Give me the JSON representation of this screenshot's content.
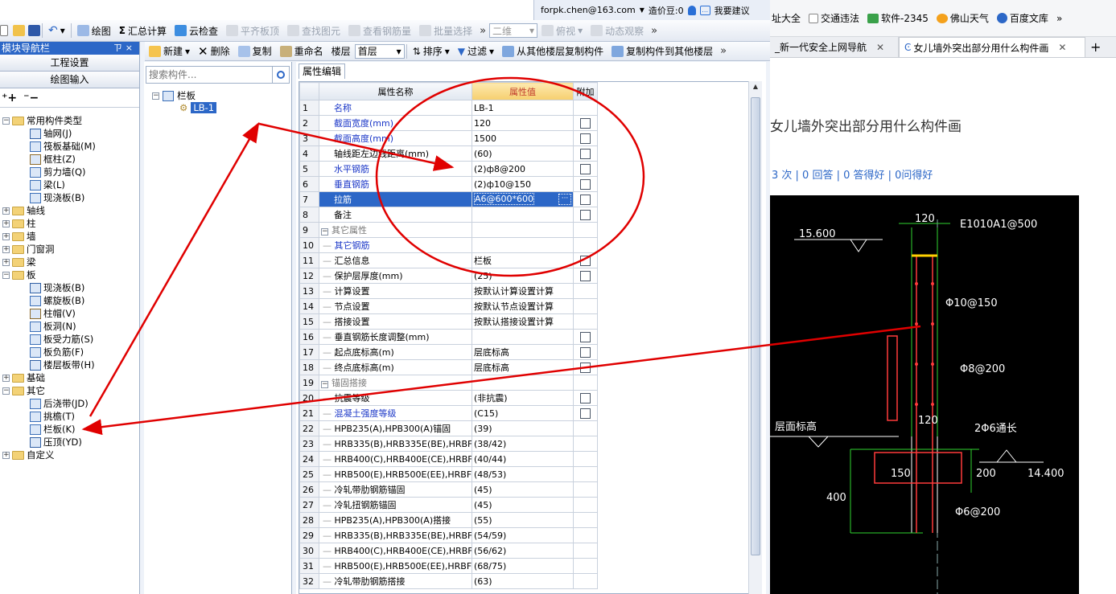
{
  "user": {
    "email": "forpk.chen@163.com",
    "bean_label": "造价豆:0",
    "suggest": "我要建议"
  },
  "toolbar1": {
    "items": [
      "绘图",
      "汇总计算",
      "云检查",
      "平齐板顶",
      "查找图元",
      "查看钢筋量",
      "批量选择"
    ],
    "view_mode": "二维",
    "view_angle": "俯视",
    "dynamic": "动态观察"
  },
  "nav": {
    "title": "模块导航栏",
    "pin": "ㄗ×",
    "btn_project": "工程设置",
    "btn_draw": "绘图输入"
  },
  "tree": [
    {
      "label": "常用构件类型",
      "level": 0,
      "type": "folder",
      "exp": "-"
    },
    {
      "label": "轴网(J)",
      "level": 1,
      "type": "item"
    },
    {
      "label": "筏板基础(M)",
      "level": 1,
      "type": "item"
    },
    {
      "label": "框柱(Z)",
      "level": 1,
      "type": "item"
    },
    {
      "label": "剪力墙(Q)",
      "level": 1,
      "type": "item"
    },
    {
      "label": "梁(L)",
      "level": 1,
      "type": "item"
    },
    {
      "label": "现浇板(B)",
      "level": 1,
      "type": "item"
    },
    {
      "label": "轴线",
      "level": 0,
      "type": "folder",
      "exp": "+"
    },
    {
      "label": "柱",
      "level": 0,
      "type": "folder",
      "exp": "+"
    },
    {
      "label": "墙",
      "level": 0,
      "type": "folder",
      "exp": "+"
    },
    {
      "label": "门窗洞",
      "level": 0,
      "type": "folder",
      "exp": "+"
    },
    {
      "label": "梁",
      "level": 0,
      "type": "folder",
      "exp": "+"
    },
    {
      "label": "板",
      "level": 0,
      "type": "folder",
      "exp": "-"
    },
    {
      "label": "现浇板(B)",
      "level": 1,
      "type": "item"
    },
    {
      "label": "螺旋板(B)",
      "level": 1,
      "type": "item"
    },
    {
      "label": "柱帽(V)",
      "level": 1,
      "type": "item"
    },
    {
      "label": "板洞(N)",
      "level": 1,
      "type": "item"
    },
    {
      "label": "板受力筋(S)",
      "level": 1,
      "type": "item"
    },
    {
      "label": "板负筋(F)",
      "level": 1,
      "type": "item"
    },
    {
      "label": "楼层板带(H)",
      "level": 1,
      "type": "item"
    },
    {
      "label": "基础",
      "level": 0,
      "type": "folder",
      "exp": "+"
    },
    {
      "label": "其它",
      "level": 0,
      "type": "folder",
      "exp": "-"
    },
    {
      "label": "后浇带(JD)",
      "level": 1,
      "type": "item"
    },
    {
      "label": "挑檐(T)",
      "level": 1,
      "type": "item"
    },
    {
      "label": "栏板(K)",
      "level": 1,
      "type": "item"
    },
    {
      "label": "压顶(YD)",
      "level": 1,
      "type": "item"
    },
    {
      "label": "自定义",
      "level": 0,
      "type": "folder",
      "exp": "+"
    }
  ],
  "toolbar2": {
    "new": "新建",
    "delete": "删除",
    "copy": "复制",
    "rename": "重命名",
    "floor_label": "楼层",
    "floor_value": "首层",
    "sort": "排序",
    "filter": "过滤",
    "copy_from": "从其他楼层复制构件",
    "copy_to": "复制构件到其他楼层"
  },
  "middle": {
    "search_placeholder": "搜索构件...",
    "group": "栏板",
    "item": "LB-1"
  },
  "props": {
    "tab": "属性编辑",
    "headers": [
      "属性名称",
      "属性值",
      "附加"
    ],
    "rows": [
      {
        "n": "1",
        "name": "名称",
        "value": "LB-1",
        "style": "blue",
        "cb": false
      },
      {
        "n": "2",
        "name": "截面宽度(mm)",
        "value": "120",
        "style": "blue",
        "cb": true
      },
      {
        "n": "3",
        "name": "截面高度(mm)",
        "value": "1500",
        "style": "blue",
        "cb": true
      },
      {
        "n": "4",
        "name": "轴线距左边线距离(mm)",
        "value": "(60)",
        "style": "",
        "cb": true
      },
      {
        "n": "5",
        "name": "水平钢筋",
        "value": "(2)ф8@200",
        "style": "blue",
        "cb": true
      },
      {
        "n": "6",
        "name": "垂直钢筋",
        "value": "(2)ф10@150",
        "style": "blue",
        "cb": true
      },
      {
        "n": "7",
        "name": "拉筋",
        "value": "A6@600*600",
        "style": "sel",
        "cb": true
      },
      {
        "n": "8",
        "name": "备注",
        "value": "",
        "style": "",
        "cb": true
      },
      {
        "n": "9",
        "name": "其它属性",
        "value": "",
        "style": "group",
        "cb": false
      },
      {
        "n": "10",
        "name": "其它钢筋",
        "value": "",
        "style": "blue-sub",
        "cb": false
      },
      {
        "n": "11",
        "name": "汇总信息",
        "value": "栏板",
        "style": "sub",
        "cb": true
      },
      {
        "n": "12",
        "name": "保护层厚度(mm)",
        "value": "(25)",
        "style": "sub",
        "cb": true
      },
      {
        "n": "13",
        "name": "计算设置",
        "value": "按默认计算设置计算",
        "style": "sub",
        "cb": false
      },
      {
        "n": "14",
        "name": "节点设置",
        "value": "按默认节点设置计算",
        "style": "sub",
        "cb": false
      },
      {
        "n": "15",
        "name": "搭接设置",
        "value": "按默认搭接设置计算",
        "style": "sub",
        "cb": false
      },
      {
        "n": "16",
        "name": "垂直钢筋长度调整(mm)",
        "value": "",
        "style": "sub",
        "cb": true
      },
      {
        "n": "17",
        "name": "起点底标高(m)",
        "value": "层底标高",
        "style": "sub",
        "cb": true
      },
      {
        "n": "18",
        "name": "终点底标高(m)",
        "value": "层底标高",
        "style": "sub",
        "cb": true
      },
      {
        "n": "19",
        "name": "锚固搭接",
        "value": "",
        "style": "group",
        "cb": false
      },
      {
        "n": "20",
        "name": "抗震等级",
        "value": "(非抗震)",
        "style": "sub",
        "cb": true
      },
      {
        "n": "21",
        "name": "混凝土强度等级",
        "value": "(C15)",
        "style": "blue-sub",
        "cb": true
      },
      {
        "n": "22",
        "name": "HPB235(A),HPB300(A)锚固",
        "value": "(39)",
        "style": "sub",
        "cb": false
      },
      {
        "n": "23",
        "name": "HRB335(B),HRB335E(BE),HRBF",
        "value": "(38/42)",
        "style": "sub",
        "cb": false
      },
      {
        "n": "24",
        "name": "HRB400(C),HRB400E(CE),HRBF",
        "value": "(40/44)",
        "style": "sub",
        "cb": false
      },
      {
        "n": "25",
        "name": "HRB500(E),HRB500E(EE),HRBF",
        "value": "(48/53)",
        "style": "sub",
        "cb": false
      },
      {
        "n": "26",
        "name": "冷轧带肋钢筋锚固",
        "value": "(45)",
        "style": "sub",
        "cb": false
      },
      {
        "n": "27",
        "name": "冷轧扭钢筋锚固",
        "value": "(45)",
        "style": "sub",
        "cb": false
      },
      {
        "n": "28",
        "name": "HPB235(A),HPB300(A)搭接",
        "value": "(55)",
        "style": "sub",
        "cb": false
      },
      {
        "n": "29",
        "name": "HRB335(B),HRB335E(BE),HRBF",
        "value": "(54/59)",
        "style": "sub",
        "cb": false
      },
      {
        "n": "30",
        "name": "HRB400(C),HRB400E(CE),HRBF",
        "value": "(56/62)",
        "style": "sub",
        "cb": false
      },
      {
        "n": "31",
        "name": "HRB500(E),HRB500E(EE),HRBF",
        "value": "(68/75)",
        "style": "sub",
        "cb": false
      },
      {
        "n": "32",
        "name": "冷轧带肋钢筋搭接",
        "value": "(63)",
        "style": "sub",
        "cb": false
      }
    ]
  },
  "browser": {
    "bookmarks": [
      "址大全",
      "交通违法",
      "软件-2345",
      "佛山天气",
      "百度文库"
    ],
    "tabs": [
      "_新一代安全上网导航",
      "女儿墙外突出部分用什么构件画"
    ],
    "question_title": "女儿墙外突出部分用什么构件画",
    "stats": "3 次 | 0 回答 | 0 答得好 | 0问得好",
    "cad_labels": {
      "top_width": "120",
      "rebar_top": "E1010A1@500",
      "elev_top": "15.600",
      "vert_rebar": "Φ10@150",
      "horiz_rebar": "Φ8@200",
      "floor_elev": "层面标高",
      "mid_width": "120",
      "bottom_rebar": "2Φ6通长",
      "dim_150": "150",
      "dim_200": "200",
      "dim_400": "400",
      "elev_bottom": "14.400",
      "stirrup": "Φ6@200"
    }
  },
  "colors": {
    "selection": "#2c67c7",
    "arrow": "#e00000",
    "cad_bg": "#000000"
  }
}
